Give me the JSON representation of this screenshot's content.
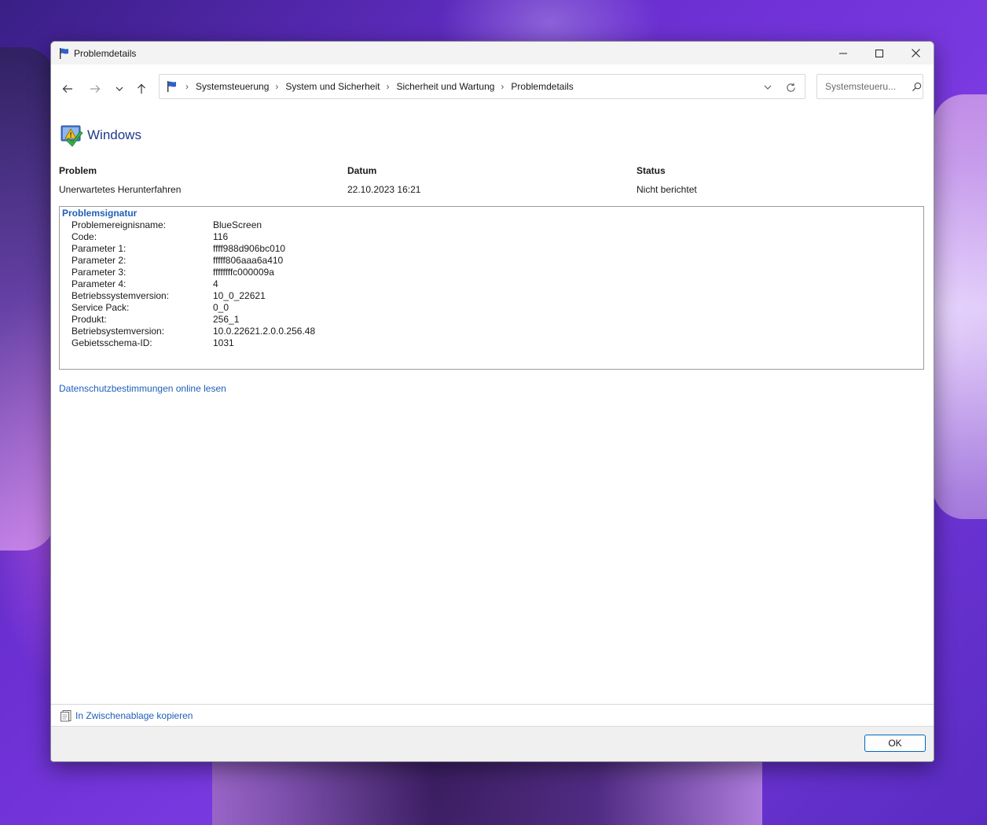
{
  "window": {
    "title": "Problemdetails"
  },
  "nav": {
    "breadcrumbs": [
      "Systemsteuerung",
      "System und Sicherheit",
      "Sicherheit und Wartung",
      "Problemdetails"
    ],
    "search_placeholder": "Systemsteueru..."
  },
  "heading": {
    "title": "Windows"
  },
  "summary": {
    "problem_header": "Problem",
    "problem_value": "Unerwartetes Herunterfahren",
    "date_header": "Datum",
    "date_value": "22.10.2023 16:21",
    "status_header": "Status",
    "status_value": "Nicht berichtet"
  },
  "signature": {
    "title": "Problemsignatur",
    "rows": [
      {
        "key": "Problemereignisname:",
        "value": "BlueScreen"
      },
      {
        "key": "Code:",
        "value": "116"
      },
      {
        "key": "Parameter 1:",
        "value": "ffff988d906bc010"
      },
      {
        "key": "Parameter 2:",
        "value": "fffff806aaa6a410"
      },
      {
        "key": "Parameter 3:",
        "value": "ffffffffc000009a"
      },
      {
        "key": "Parameter 4:",
        "value": "4"
      },
      {
        "key": "Betriebssystemversion:",
        "value": "10_0_22621"
      },
      {
        "key": "Service Pack:",
        "value": "0_0"
      },
      {
        "key": "Produkt:",
        "value": "256_1"
      },
      {
        "key": "Betriebsystemversion:",
        "value": "10.0.22621.2.0.0.256.48"
      },
      {
        "key": "Gebietsschema-ID:",
        "value": "1031"
      }
    ]
  },
  "links": {
    "privacy": "Datenschutzbestimmungen online lesen",
    "copy": "In Zwischenablage kopieren"
  },
  "footer": {
    "ok_label": "OK"
  }
}
